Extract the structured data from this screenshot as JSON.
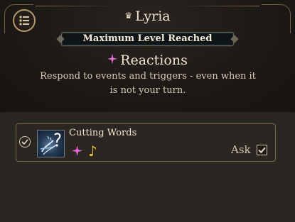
{
  "header": {
    "character_name": "Lyria",
    "crown_icon": "♛",
    "menu_icon": "list-menu-icon"
  },
  "level_banner": {
    "text": "Maximum Level Reached"
  },
  "section": {
    "title": "Reactions",
    "description": "Respond to events and triggers - even when it is not your turn."
  },
  "reactions": [
    {
      "name": "Cutting Words",
      "enabled": true,
      "ask_label": "Ask",
      "ask_checked": true,
      "icon": "cutting-words-spell-icon",
      "tags": [
        "sparkle-reaction-icon",
        "music-note-icon"
      ],
      "music_glyph": "♪"
    }
  ],
  "colors": {
    "accent_pink": "#e86ad6",
    "accent_gold": "#e8c03a",
    "frame_gold": "#8a7350"
  }
}
